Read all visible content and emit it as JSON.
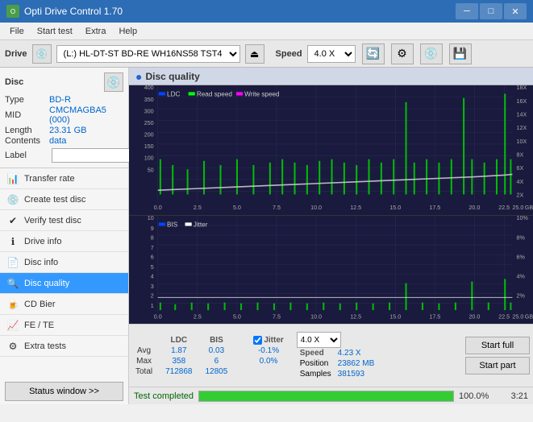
{
  "titleBar": {
    "title": "Opti Drive Control 1.70",
    "minimize": "─",
    "maximize": "□",
    "close": "✕"
  },
  "menuBar": {
    "items": [
      "File",
      "Start test",
      "Extra",
      "Help"
    ]
  },
  "driveBar": {
    "label": "Drive",
    "driveValue": "(L:)  HL-DT-ST BD-RE  WH16NS58 TST4",
    "speedLabel": "Speed",
    "speedValue": "4.0 X"
  },
  "disc": {
    "title": "Disc",
    "typeLabel": "Type",
    "typeValue": "BD-R",
    "midLabel": "MID",
    "midValue": "CMCMAGBA5 (000)",
    "lengthLabel": "Length",
    "lengthValue": "23.31 GB",
    "contentsLabel": "Contents",
    "contentsValue": "data",
    "labelLabel": "Label",
    "labelValue": ""
  },
  "sidebar": {
    "items": [
      {
        "id": "transfer-rate",
        "label": "Transfer rate",
        "icon": "📊"
      },
      {
        "id": "create-test-disc",
        "label": "Create test disc",
        "icon": "💿"
      },
      {
        "id": "verify-test-disc",
        "label": "Verify test disc",
        "icon": "✔"
      },
      {
        "id": "drive-info",
        "label": "Drive info",
        "icon": "ℹ"
      },
      {
        "id": "disc-info",
        "label": "Disc info",
        "icon": "📄"
      },
      {
        "id": "disc-quality",
        "label": "Disc quality",
        "icon": "🔍",
        "active": true
      },
      {
        "id": "cd-bier",
        "label": "CD Bier",
        "icon": "🍺"
      },
      {
        "id": "fe-te",
        "label": "FE / TE",
        "icon": "📈"
      },
      {
        "id": "extra-tests",
        "label": "Extra tests",
        "icon": "⚙"
      }
    ],
    "statusBtn": "Status window >>"
  },
  "content": {
    "title": "Disc quality",
    "chart1": {
      "legend": [
        "LDC",
        "Read speed",
        "Write speed"
      ],
      "yAxisMax": 400,
      "yAxisRightMax": 18,
      "xAxisMax": 25,
      "rightLabels": [
        "18X",
        "16X",
        "14X",
        "12X",
        "10X",
        "8X",
        "6X",
        "4X",
        "2X"
      ]
    },
    "chart2": {
      "legend": [
        "BIS",
        "Jitter"
      ],
      "yAxisMax": 10,
      "yAxisRightMax": 10,
      "xAxisMax": 25
    }
  },
  "stats": {
    "headers": [
      "",
      "LDC",
      "BIS",
      "",
      "Jitter",
      "Speed",
      ""
    ],
    "avg": {
      "label": "Avg",
      "ldc": "1.87",
      "bis": "0.03",
      "jitter": "-0.1%"
    },
    "max": {
      "label": "Max",
      "ldc": "358",
      "bis": "6",
      "jitter": "0.0%"
    },
    "total": {
      "label": "Total",
      "ldc": "712868",
      "bis": "12805"
    },
    "speedValue": "4.23 X",
    "speedDropdown": "4.0 X",
    "positionLabel": "Position",
    "positionValue": "23862 MB",
    "samplesLabel": "Samples",
    "samplesValue": "381593",
    "startFullBtn": "Start full",
    "startPartBtn": "Start part",
    "jitterChecked": true,
    "jitterLabel": "Jitter"
  },
  "progressBar": {
    "fillPercent": 100,
    "percentText": "100.0%",
    "statusText": "Test completed",
    "time": "3:21"
  }
}
